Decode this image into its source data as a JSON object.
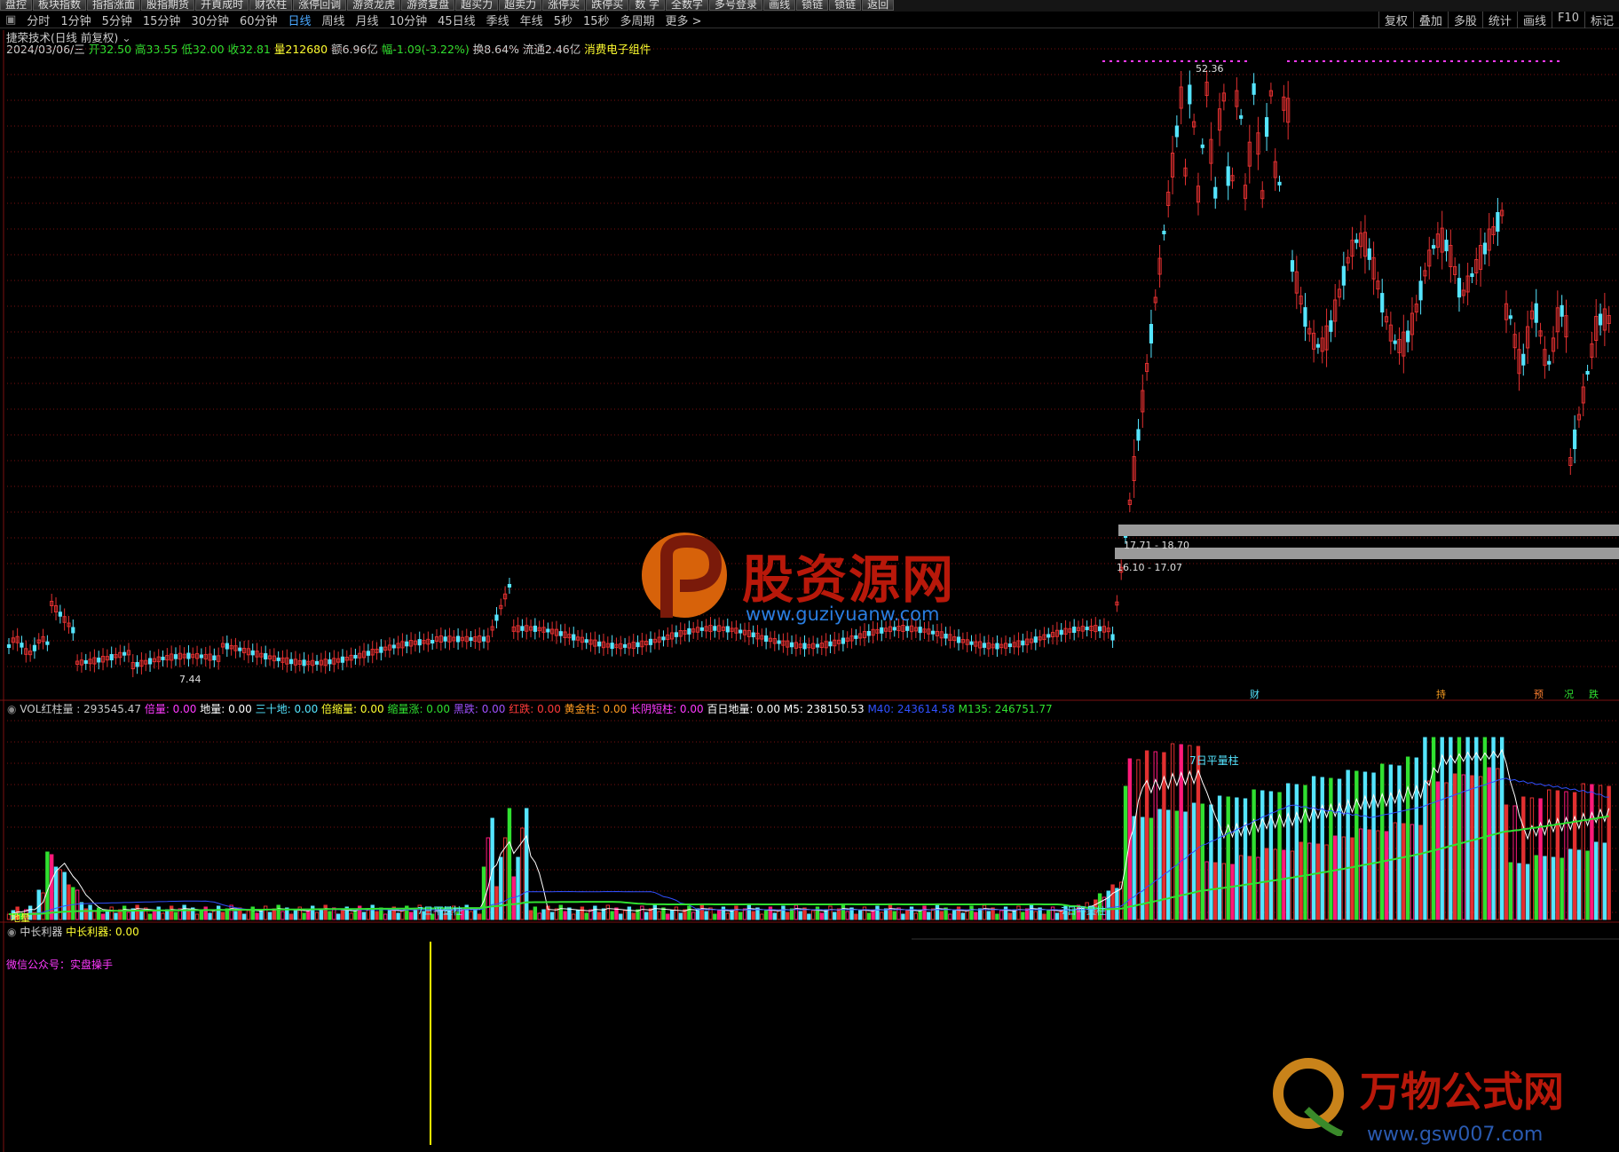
{
  "toolbar": {
    "buttons": [
      "盘控",
      "板块指数",
      "指指涨面",
      "股指期货",
      "开頁成时",
      "财农柱",
      "涨停回调",
      "游资龙虎",
      "游资复盘",
      "超买力",
      "超卖力",
      "涨停买",
      "跌停买",
      "数 字",
      "全数字",
      "多号登录",
      "画线",
      "锁链",
      "锁链",
      "返回"
    ]
  },
  "periods": {
    "items": [
      "分时",
      "1分钟",
      "5分钟",
      "15分钟",
      "30分钟",
      "60分钟",
      "日线",
      "周线",
      "月线",
      "10分钟",
      "45日线",
      "季线",
      "年线",
      "5秒",
      "15秒",
      "多周期",
      "更多 >"
    ],
    "active": "日线"
  },
  "right_tools": [
    "复权",
    "叠加",
    "多股",
    "统计",
    "画线",
    "F10",
    "标记"
  ],
  "header": {
    "title": "捷荣技术(日线 前复权)",
    "date": "2024/03/06/三",
    "open": "开32.50",
    "high": "高33.55",
    "low": "低32.00",
    "close": "收32.81",
    "volume": "量212680",
    "amount": "额6.96亿",
    "change": "幅-1.09(-3.22%)",
    "turnover": "换8.64%",
    "float": "流通2.46亿",
    "sector": "消费电子组件"
  },
  "main_chart": {
    "price_high_label": "52.36",
    "price_low_label": "7.44",
    "range_bands": [
      "17.71 - 18.70",
      "16.10 - 17.07"
    ],
    "markers": [
      "财",
      "持",
      "预",
      "况",
      "跌"
    ]
  },
  "watermarks": {
    "center_name": "股资源网",
    "center_url": "www.guziyuanw.com",
    "corner_name": "万物公式网",
    "corner_url": "www.gsw007.com"
  },
  "vol_panel": {
    "items": [
      {
        "label": "VOL红柱量 : 293545.47",
        "color": "#c8c8c8"
      },
      {
        "label": "倍量: 0.00",
        "color": "#ff3aff"
      },
      {
        "label": "地量: 0.00",
        "color": "#ffffff"
      },
      {
        "label": "三十地: 0.00",
        "color": "#55e5ff"
      },
      {
        "label": "倍缩量: 0.00",
        "color": "#ffff30"
      },
      {
        "label": "缩量涨: 0.00",
        "color": "#30e030"
      },
      {
        "label": "黑跌: 0.00",
        "color": "#a050ff"
      },
      {
        "label": "红跌: 0.00",
        "color": "#ff3a3a"
      },
      {
        "label": "黄金柱: 0.00",
        "color": "#ff9a20"
      },
      {
        "label": "长阴短柱: 0.00",
        "color": "#ff3aff"
      },
      {
        "label": "百日地量: 0.00",
        "color": "#ffffff"
      },
      {
        "label": "M5: 238150.53",
        "color": "#ffffff"
      },
      {
        "label": "M40: 243614.58",
        "color": "#3050ff"
      },
      {
        "label": "M135: 246751.77",
        "color": "#30e030"
      }
    ],
    "inline_labels": [
      "7日平量柱",
      "地量",
      "7日平量柱",
      "7日平量柱"
    ]
  },
  "lower_panel": {
    "title": "中长利器",
    "value": "中长利器: 0.00",
    "note": "微信公众号：实盘操手"
  },
  "colors": {
    "up": "#e23030",
    "down": "#55e5ff",
    "grid": "#7a1010",
    "ma5": "#ffffff",
    "ma40": "#3050ff",
    "ma135": "#30e030"
  }
}
